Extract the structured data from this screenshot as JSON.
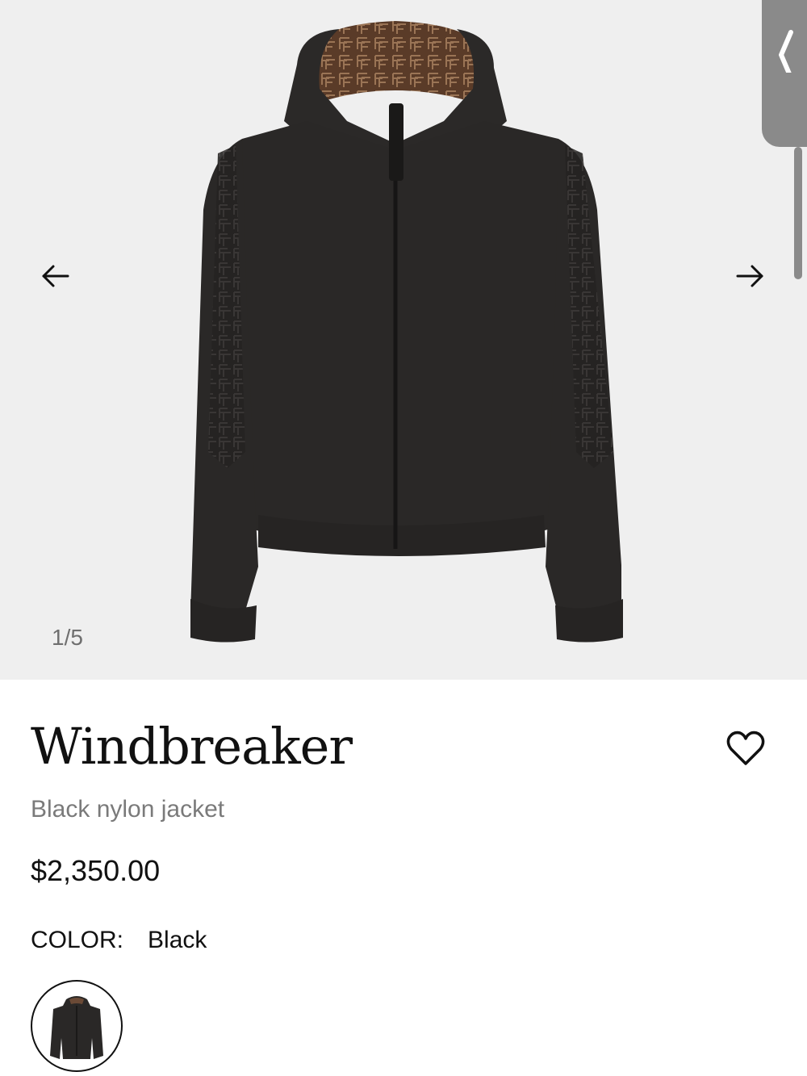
{
  "gallery": {
    "counter": "1/5",
    "prev_icon": "arrow-left-icon",
    "next_icon": "arrow-right-icon",
    "side_tab_icon": "chevron-left-icon"
  },
  "product": {
    "title": "Windbreaker",
    "subtitle": "Black nylon jacket",
    "price": "$2,350.00",
    "color_label": "COLOR:",
    "color_value": "Black",
    "favorite_icon": "heart-outline-icon",
    "swatches": [
      {
        "name": "Black",
        "selected": true
      }
    ]
  },
  "colors": {
    "gallery_bg": "#efefef",
    "jacket": "#2a2827",
    "lining": "#6b4a36",
    "side_tab": "#8a8a8a",
    "subtitle_text": "#7a7a7a"
  }
}
